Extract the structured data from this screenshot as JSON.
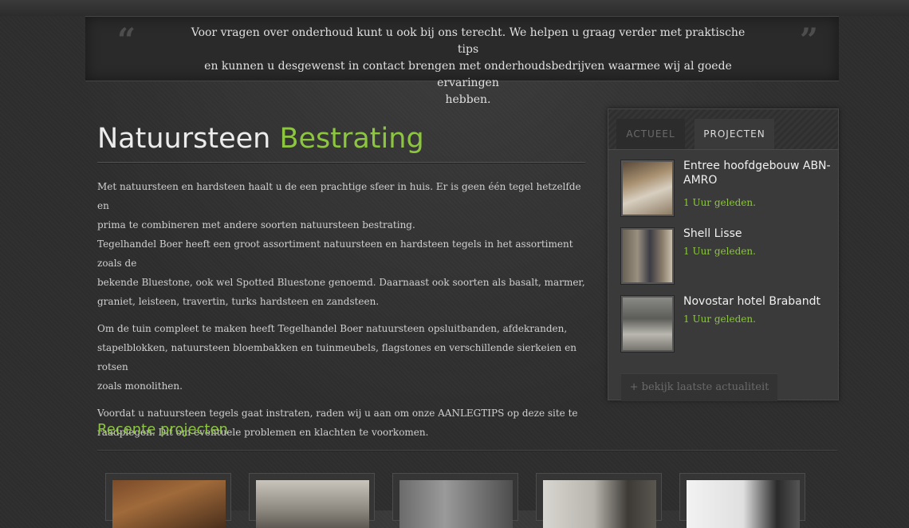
{
  "quote": {
    "lines": [
      "Voor vragen over onderhoud kunt u ook bij ons terecht. We helpen u graag verder met praktische tips",
      "en kunnen u desgewenst in contact brengen met onderhoudsbedrijven waarmee wij al goede ervaringen",
      "hebben."
    ],
    "open_mark": "“",
    "close_mark": "”"
  },
  "page": {
    "title_main": "Natuursteen",
    "title_accent": "Bestrating",
    "paragraphs": [
      [
        "Met natuursteen en hardsteen haalt u de een prachtige sfeer in huis. Er is geen één tegel hetzelfde en",
        "prima te combineren met andere soorten natuursteen bestrating.",
        "Tegelhandel Boer heeft een groot assortiment natuursteen en hardsteen tegels in het assortiment zoals de",
        "bekende Bluestone, ook wel Spotted Bluestone genoemd. Daarnaast ook soorten als basalt, marmer,",
        "graniet, leisteen, travertin, turks hardsteen en zandsteen."
      ],
      [
        "Om de tuin compleet te maken heeft Tegelhandel Boer natuursteen opsluitbanden, afdekranden,",
        "stapelblokken, natuursteen bloembakken en tuinmeubels, flagstones en verschillende sierkeien en rotsen",
        "zoals monolithen."
      ],
      [
        "Voordat u natuursteen tegels gaat instraten, raden wij u aan om onze AANLEGTIPS op deze site te",
        "raadplegen. Dit om eventuele problemen en klachten te voorkomen."
      ]
    ]
  },
  "sidebar": {
    "tabs": [
      "ACTUEEL",
      "PROJECTEN"
    ],
    "active_tab": "PROJECTEN",
    "projects": [
      {
        "name": "Entree hoofdgebouw ABN-AMRO",
        "time": "1 Uur geleden."
      },
      {
        "name": "Shell Lisse",
        "time": "1 Uur geleden."
      },
      {
        "name": "Novostar hotel Brabandt",
        "time": "1 Uur geleden."
      }
    ],
    "more_label": "+ bekijk laatste actualiteit"
  },
  "recent": {
    "title": "Recente projecten"
  },
  "colors": {
    "accent": "#8cc63f",
    "background": "#2e2e2e",
    "panel": "#3a3a3a"
  }
}
